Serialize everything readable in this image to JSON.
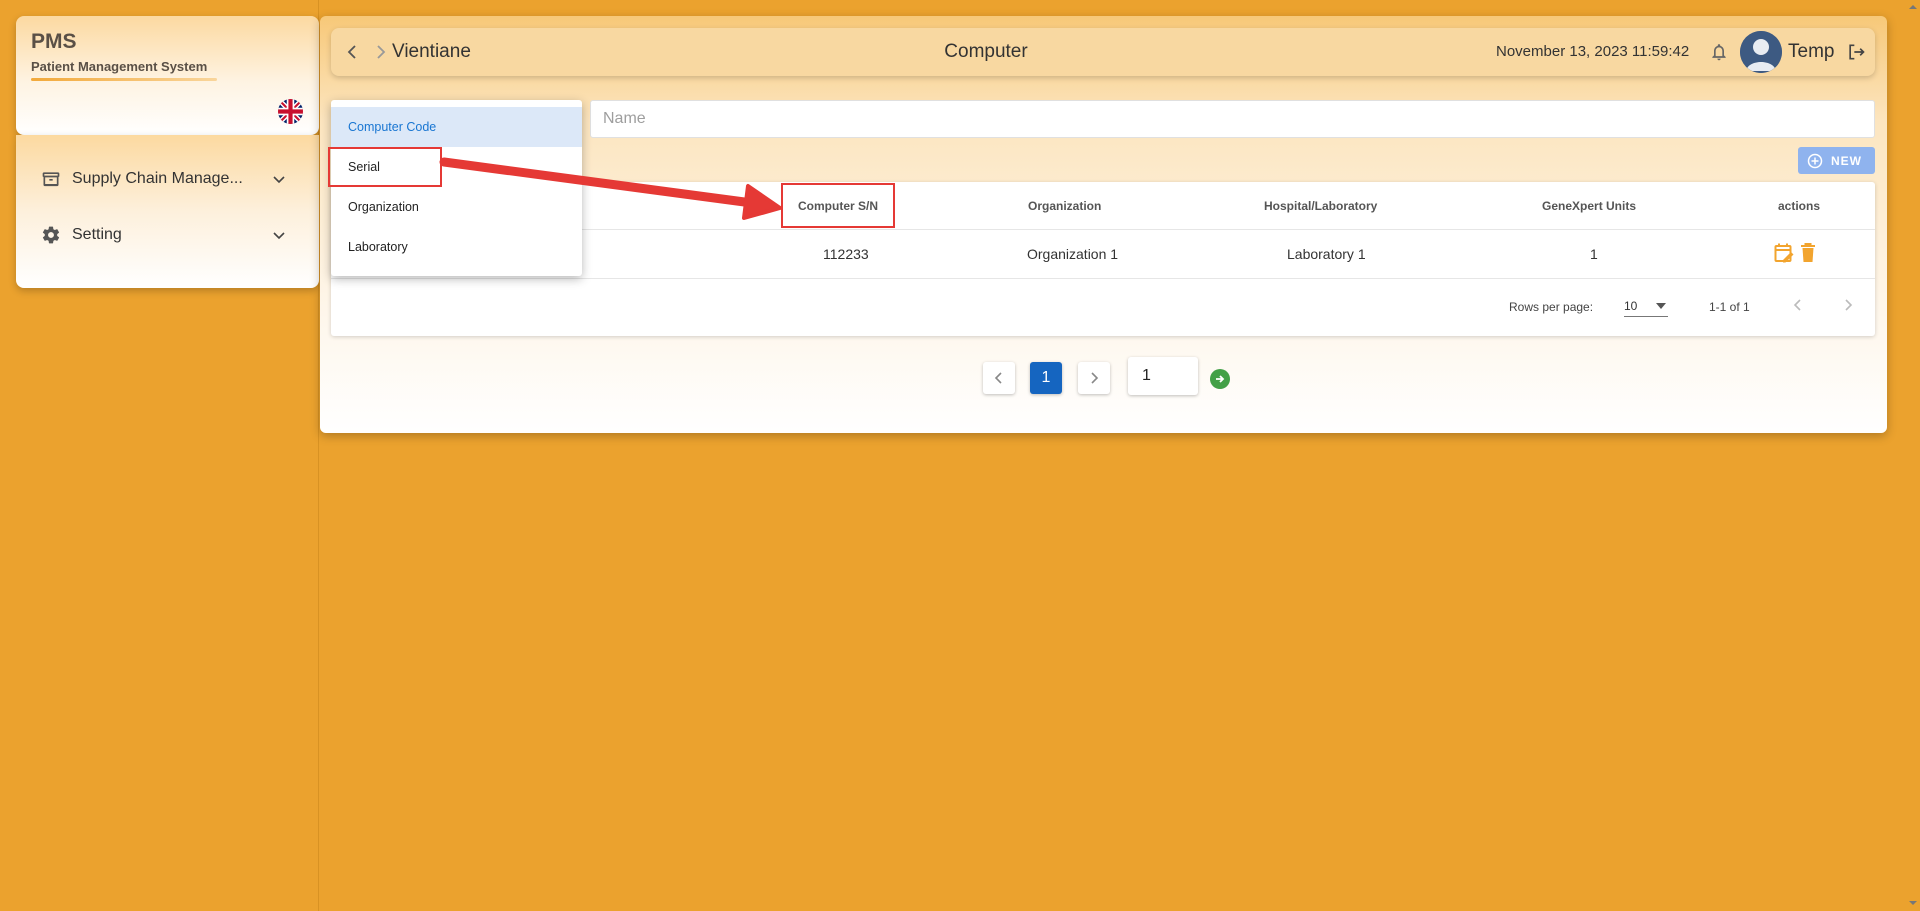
{
  "app": {
    "name": "PMS",
    "subtitle": "Patient Management System",
    "language_flag": "uk-flag-icon"
  },
  "sidebar": {
    "items": [
      {
        "label": "Supply Chain Manage...",
        "icon": "archive-box-icon"
      },
      {
        "label": "Setting",
        "icon": "gear-icon"
      }
    ]
  },
  "topbar": {
    "location": "Vientiane",
    "title": "Computer",
    "datetime": "November 13, 2023 11:59:42",
    "user": "Temp"
  },
  "filter": {
    "options": [
      "Computer Code",
      "Serial",
      "Organization",
      "Laboratory"
    ],
    "selected": "Computer Code",
    "placeholder": "Name",
    "value": ""
  },
  "toolbar": {
    "new_label": "NEW"
  },
  "table": {
    "columns": [
      "Computer S/N",
      "Organization",
      "Hospital/Laboratory",
      "GeneXpert Units",
      "actions"
    ],
    "rows": [
      {
        "serial": "112233",
        "organization": "Organization 1",
        "laboratory": "Laboratory 1",
        "units": "1"
      }
    ],
    "rows_per_page_label": "Rows per page:",
    "rows_per_page": "10",
    "range": "1-1 of 1"
  },
  "pagination": {
    "current_page": "1",
    "goto_value": "1"
  },
  "colors": {
    "background": "#EBA22E",
    "accent": "#1565C0",
    "action_orange": "#F2A42E",
    "highlight_red": "#E53935"
  }
}
